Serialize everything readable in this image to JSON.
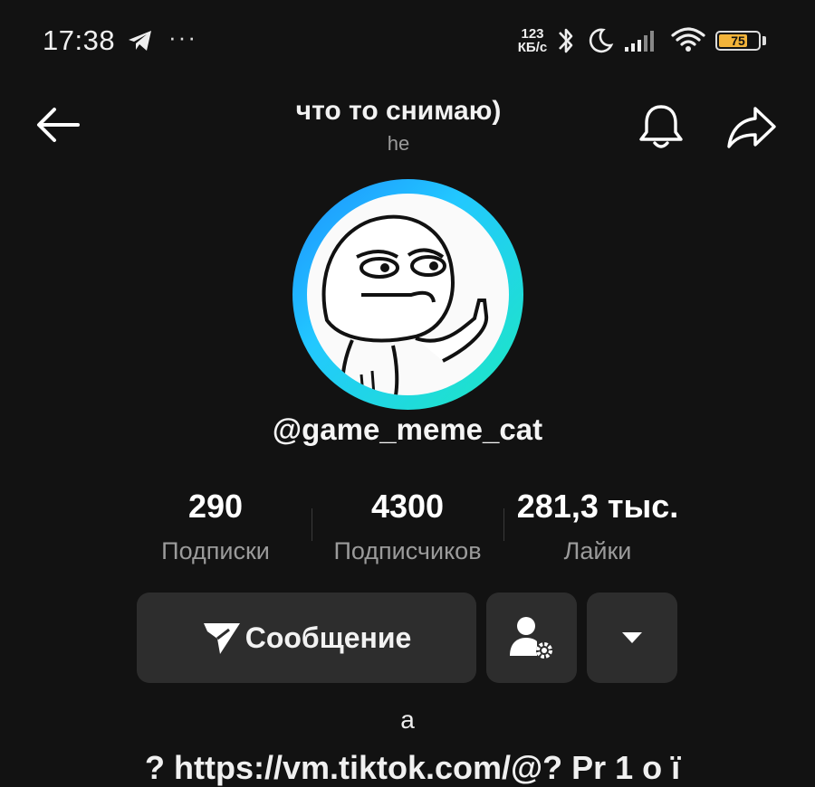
{
  "status_bar": {
    "time": "17:38",
    "more_indicator": "···",
    "net_speed_value": "123",
    "net_speed_unit": "КБ/с",
    "battery_level": "75",
    "battery_color": "#f3b43a",
    "icons": [
      "telegram-icon",
      "bluetooth-icon",
      "do-not-disturb-moon-icon",
      "signal-icon",
      "wifi-icon",
      "battery-icon"
    ]
  },
  "header": {
    "title": "что то снимаю)",
    "subtitle": "he",
    "icons": [
      "back-arrow-icon",
      "bell-icon",
      "share-icon"
    ]
  },
  "profile": {
    "username": "@game_meme_cat",
    "avatar_ring_colors": [
      "#1d8fff",
      "#22c8ff",
      "#1de9c0"
    ]
  },
  "stats": [
    {
      "value": "290",
      "label": "Подписки"
    },
    {
      "value": "4300",
      "label": "Подписчиков"
    },
    {
      "value": "281,3 тыс.",
      "label": "Лайки"
    }
  ],
  "actions": {
    "message_label": "Сообщение",
    "icons": [
      "send-icon",
      "user-settings-icon",
      "caret-down-icon"
    ]
  },
  "bio": {
    "line1": "a",
    "link_partial": "? https://vm.tiktok.com/@? Pr 1 о ї"
  },
  "colors": {
    "background": "#121212",
    "button": "#2d2d2d",
    "muted_text": "#9b9b9b"
  }
}
